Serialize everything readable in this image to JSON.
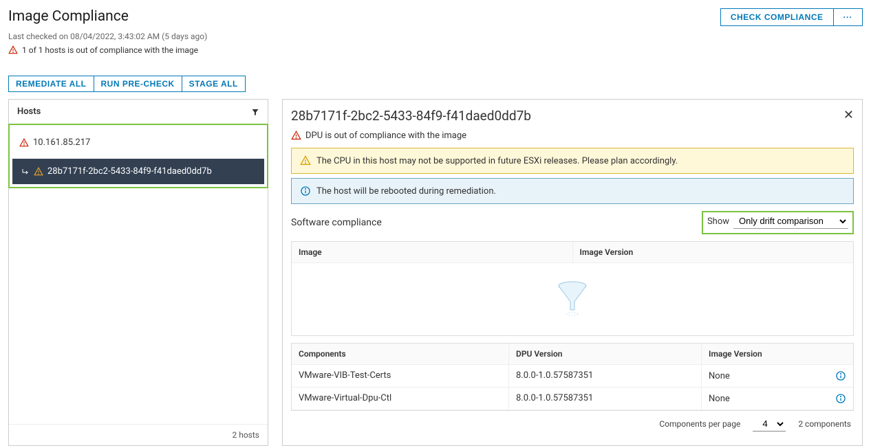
{
  "header": {
    "title": "Image Compliance",
    "last_checked": "Last checked on 08/04/2022, 3:43:02 AM (5 days ago)",
    "compliance_summary": "1 of 1 hosts is out of compliance with the image",
    "check_compliance": "CHECK COMPLIANCE",
    "more": "···"
  },
  "actions": {
    "remediate": "REMEDIATE ALL",
    "precheck": "RUN PRE-CHECK",
    "stage": "STAGE ALL"
  },
  "hosts_panel": {
    "header": "Hosts",
    "items": [
      {
        "label": "10.161.85.217"
      },
      {
        "label": "28b7171f-2bc2-5433-84f9-f41daed0dd7b"
      }
    ],
    "footer": "2 hosts"
  },
  "detail": {
    "title": "28b7171f-2bc2-5433-84f9-f41daed0dd7b",
    "sub": "DPU is out of compliance with the image",
    "warn_msg": "The CPU in this host may not be supported in future ESXi releases. Please plan accordingly.",
    "info_msg": "The host will be rebooted during remediation.",
    "sw_title": "Software compliance",
    "show_label": "Show",
    "show_value": "Only drift comparison",
    "table1": {
      "h1": "Image",
      "h2": "Image Version"
    },
    "table2": {
      "h1": "Components",
      "h2": "DPU Version",
      "h3": "Image Version",
      "rows": [
        {
          "c1": "VMware-VIB-Test-Certs",
          "c2": "8.0.0-1.0.57587351",
          "c3": "None"
        },
        {
          "c1": "VMware-Virtual-Dpu-Ctl",
          "c2": "8.0.0-1.0.57587351",
          "c3": "None"
        }
      ]
    },
    "pagination": {
      "label": "Components per page",
      "value": "4",
      "total": "2 components"
    }
  }
}
